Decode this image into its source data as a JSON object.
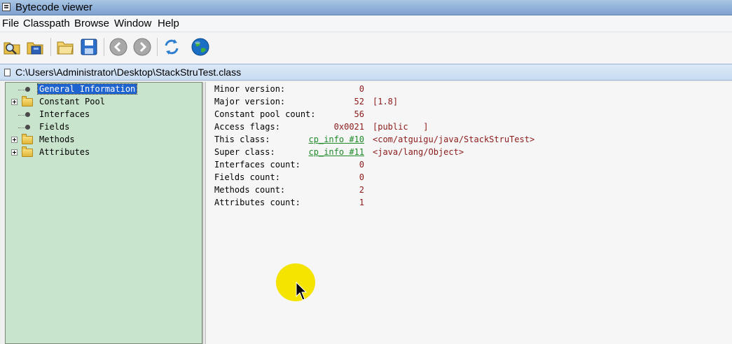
{
  "window": {
    "title": "Bytecode viewer"
  },
  "menu": [
    "File",
    "Classpath",
    "Browse",
    "Window",
    "Help"
  ],
  "toolbar": {
    "icons": [
      "open-class-icon",
      "open-jar-icon",
      "open-folder-icon",
      "save-icon",
      "back-icon",
      "forward-icon",
      "refresh-icon",
      "web-icon"
    ],
    "colors": {
      "back": "#9a9a9a",
      "refresh": "#2f7fd0",
      "globe": "#1a6fc4"
    }
  },
  "path": "C:\\Users\\Administrator\\Desktop\\StackStruTest.class",
  "tree": {
    "items": [
      {
        "label": "General Information",
        "type": "leaf",
        "selected": true
      },
      {
        "label": "Constant Pool",
        "type": "folder"
      },
      {
        "label": "Interfaces",
        "type": "leaf"
      },
      {
        "label": "Fields",
        "type": "leaf"
      },
      {
        "label": "Methods",
        "type": "folder"
      },
      {
        "label": "Attributes",
        "type": "folder"
      }
    ]
  },
  "info": {
    "rows": [
      {
        "key": "Minor version:",
        "value": "0",
        "extra": ""
      },
      {
        "key": "Major version:",
        "value": "52",
        "extra": "[1.8]"
      },
      {
        "key": "Constant pool count:",
        "value": "56",
        "extra": ""
      },
      {
        "key": "Access flags:",
        "value": "0x0021",
        "extra": "[public   ]"
      },
      {
        "key": "This class:",
        "link": "cp_info #10",
        "extra": "<com/atguigu/java/StackStruTest>"
      },
      {
        "key": "Super class:",
        "link": "cp_info #11",
        "extra": "<java/lang/Object>"
      },
      {
        "key": "Interfaces count:",
        "value": "0",
        "extra": ""
      },
      {
        "key": "Fields count:",
        "value": "0",
        "extra": ""
      },
      {
        "key": "Methods count:",
        "value": "2",
        "extra": ""
      },
      {
        "key": "Attributes count:",
        "value": "1",
        "extra": ""
      }
    ]
  },
  "colors": {
    "tree_bg": "#c9e4cc",
    "selection": "#1e64d0",
    "value": "#8b1a1a",
    "link": "#1f8a2a",
    "cursor_highlight": "#f4e400"
  }
}
